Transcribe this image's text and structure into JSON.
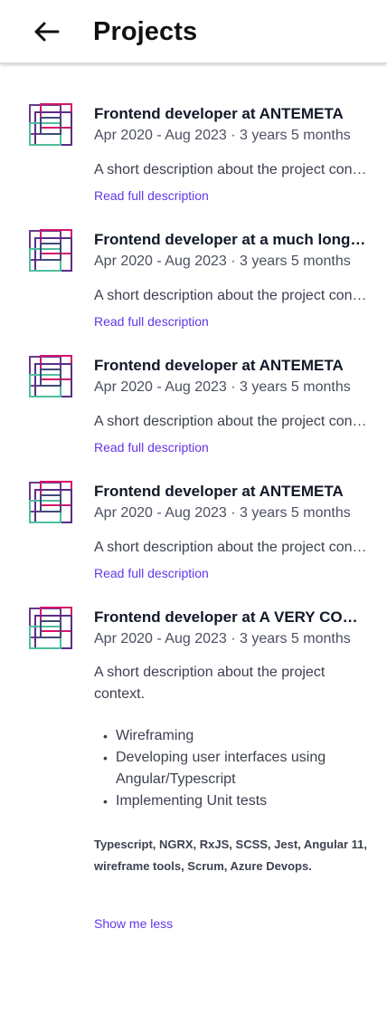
{
  "header": {
    "back_icon": "arrow-left-icon",
    "title": "Projects"
  },
  "logo_icon": "stacked-squares-logo-icon",
  "projects": [
    {
      "title": "Frontend developer at ANTEMETA",
      "dates": "Apr 2020 - Aug 2023 · 3 years 5 months",
      "description": "A short description about the project context.",
      "link": "Read full description"
    },
    {
      "title": "Frontend developer at a much longer company name",
      "dates": "Apr 2020 - Aug 2023 · 3 years 5 months",
      "description": "A short description about the project context.",
      "link": "Read full description"
    },
    {
      "title": "Frontend developer at ANTEMETA",
      "dates": "Apr 2020 - Aug 2023 · 3 years 5 months",
      "description": "A short description about the project context.",
      "link": "Read full description"
    },
    {
      "title": "Frontend developer at ANTEMETA",
      "dates": "Apr 2020 - Aug 2023 · 3 years 5 months",
      "description": "A short description about the project context.",
      "link": "Read full description"
    },
    {
      "title": "Frontend developer at A VERY COOL COMPANY",
      "dates": "Apr 2020 - Aug 2023 · 3 years 5 months",
      "description": "A short description about the project context.",
      "bullets": [
        "Wireframing",
        "Developing user interfaces using Angular/Typescript",
        "Implementing Unit tests"
      ],
      "technologies": "Typescript, NGRX, RxJS, SCSS, Jest, Angular 11, wireframe tools, Scrum, Azure Devops.",
      "link": "Show me less"
    }
  ],
  "colors": {
    "link": "#6236e8",
    "logo_magenta": "#d6156b",
    "logo_purple": "#5b2d86",
    "logo_teal": "#4fbf9f"
  }
}
